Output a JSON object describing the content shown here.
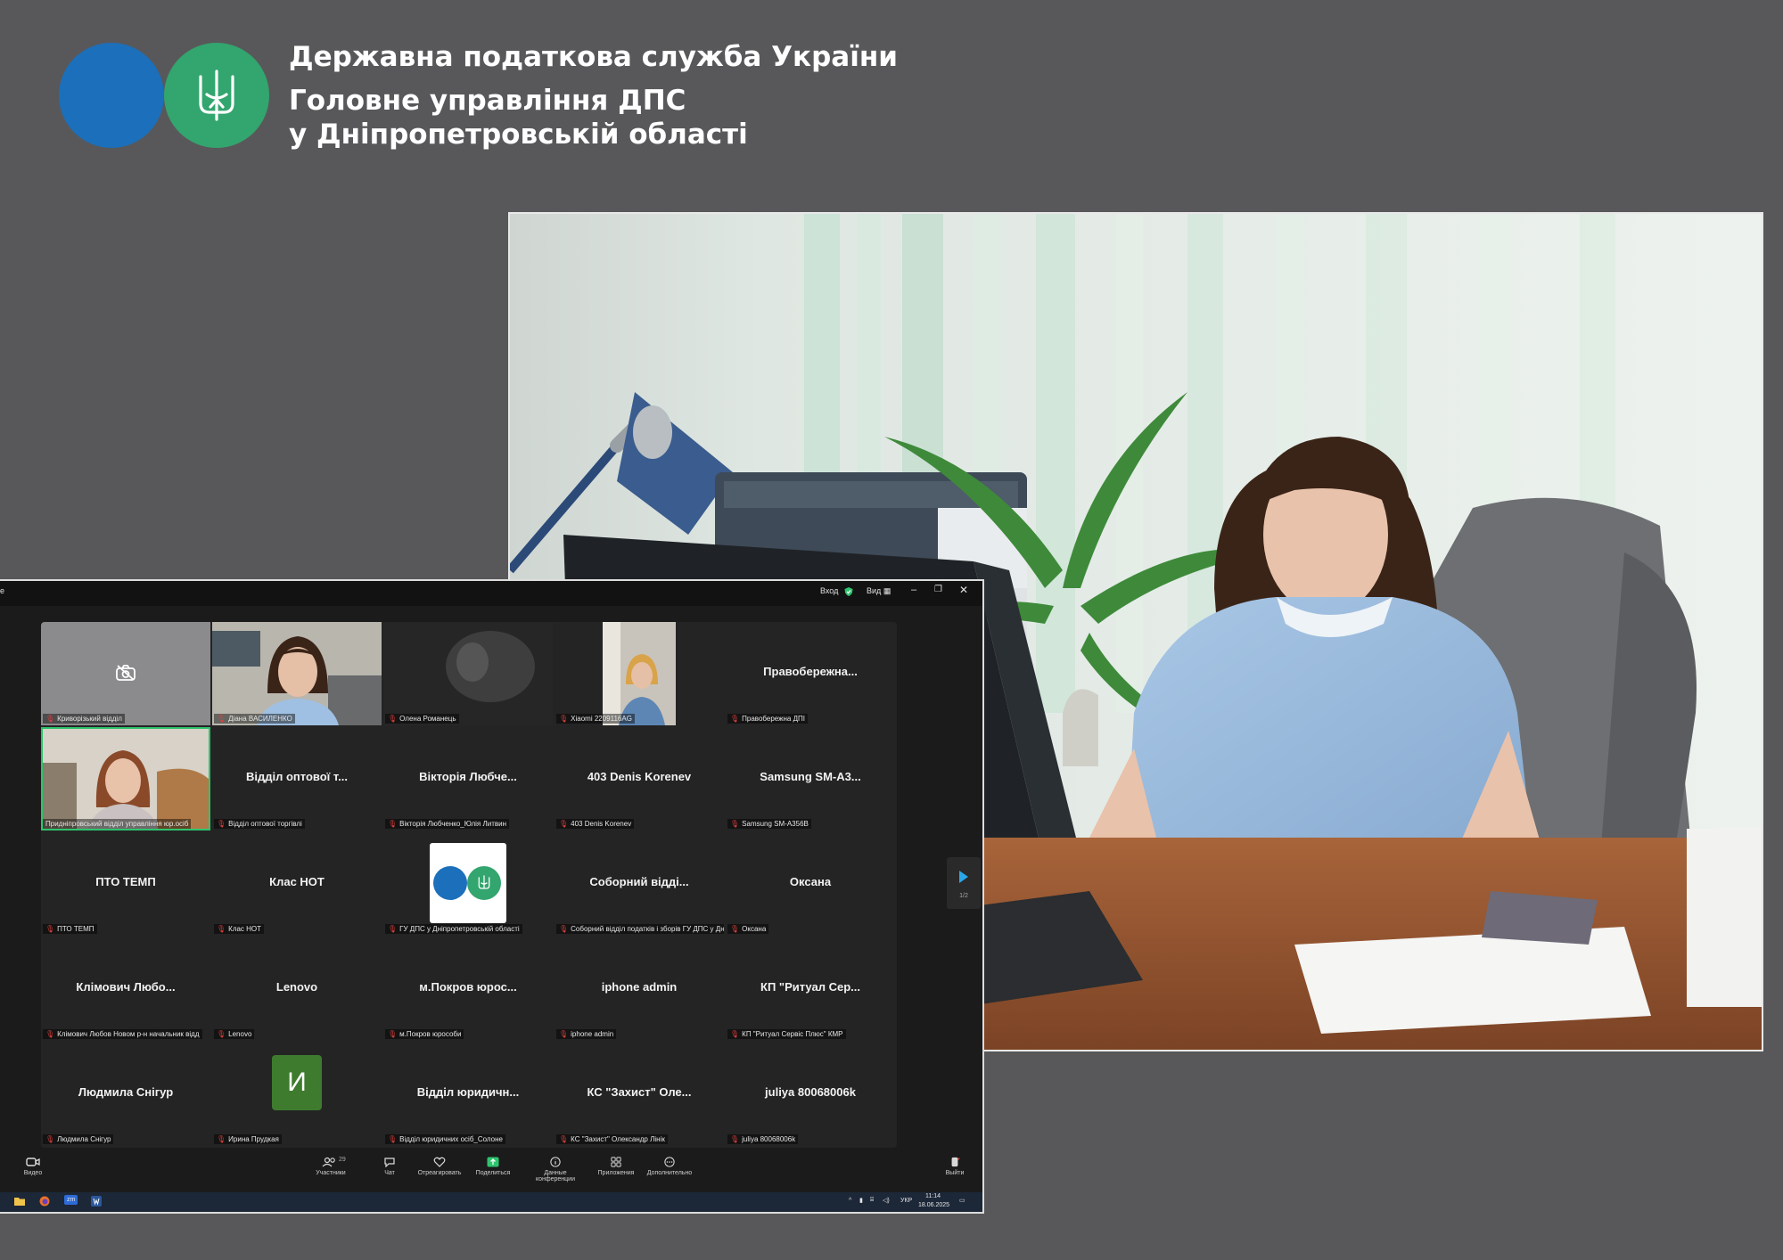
{
  "header": {
    "line1": "Державна податкова служба України",
    "line2": "Головне управління ДПС",
    "line3": "у Дніпропетровській області"
  },
  "logo": {
    "colors": {
      "left": "#1c6fba",
      "right": "#33a56e"
    },
    "emblem": "trident-icon"
  },
  "zoom": {
    "titlebar": {
      "left_fragment": "e",
      "login": "Вход",
      "view": "Вид"
    },
    "tiles": [
      {
        "name": "",
        "label": "Криворізький відділ",
        "kind": "camera-off"
      },
      {
        "name": "",
        "label": "Діана ВАСИЛЕНКО",
        "kind": "video-person"
      },
      {
        "name": "",
        "label": "Олена Романець",
        "kind": "video-dark"
      },
      {
        "name": "",
        "label": "Xiaomi 2209116AG",
        "kind": "video-person-small"
      },
      {
        "name": "Правобережна...",
        "label": "Правобережна ДПІ",
        "kind": "text"
      },
      {
        "name": "",
        "label": "Придніпровський відділ управління юр.осіб",
        "kind": "video-active"
      },
      {
        "name": "Відділ оптової т...",
        "label": "Відділ оптової торгівлі",
        "kind": "text"
      },
      {
        "name": "Вікторія Любче...",
        "label": "Вікторія Любченко_Юлія Литвин",
        "kind": "text"
      },
      {
        "name": "403 Denis Korenev",
        "label": "403 Denis Korenev",
        "kind": "text"
      },
      {
        "name": "Samsung SM-A3...",
        "label": "Samsung SM-A356B",
        "kind": "text"
      },
      {
        "name": "ПТО ТЕМП",
        "label": "ПТО ТЕМП",
        "kind": "text"
      },
      {
        "name": "Клас НОТ",
        "label": "Клас НОТ",
        "kind": "text"
      },
      {
        "name": "",
        "label": "ГУ ДПС у Дніпропетровській області",
        "kind": "logo"
      },
      {
        "name": "Соборний відді...",
        "label": "Соборний відділ податків і зборів ГУ ДПС у Дн...",
        "kind": "text"
      },
      {
        "name": "Оксана",
        "label": "Оксана",
        "kind": "text"
      },
      {
        "name": "Клімович Любо...",
        "label": "Клімович Любов Новом р-н начальник відд",
        "kind": "text"
      },
      {
        "name": "Lenovo",
        "label": "Lenovo",
        "kind": "text"
      },
      {
        "name": "м.Покров юрос...",
        "label": "м.Покров юрособи",
        "kind": "text"
      },
      {
        "name": "iphone admin",
        "label": "iphone admin",
        "kind": "text"
      },
      {
        "name": "КП \"Ритуал Сер...",
        "label": "КП \"Ритуал Сервіс Плюс\" КМР",
        "kind": "text"
      },
      {
        "name": "Людмила Снігур",
        "label": "Людмила Снігур",
        "kind": "text"
      },
      {
        "name": "И",
        "label": "Ирина Прудкая",
        "kind": "avatar"
      },
      {
        "name": "Відділ юридичн...",
        "label": "Відділ юридичних осіб_Солоне",
        "kind": "text"
      },
      {
        "name": "КС \"Захист\" Оле...",
        "label": "КС \"Захист\" Олександр Лінік",
        "kind": "text"
      },
      {
        "name": "juliya 80068006k",
        "label": "juliya 80068006k",
        "kind": "text"
      }
    ],
    "page_indicator": "1/2",
    "toolbar": {
      "video": "Видео",
      "participants": "Участники",
      "participants_count": "29",
      "chat": "Чат",
      "react": "Отреагировать",
      "share": "Поделиться",
      "info": "Данные конференции",
      "apps": "Приложения",
      "more": "Дополнительно",
      "leave": "Выйти"
    },
    "taskbar": {
      "time": "11:14",
      "date": "18.06.2025",
      "lang": "УКР"
    }
  }
}
